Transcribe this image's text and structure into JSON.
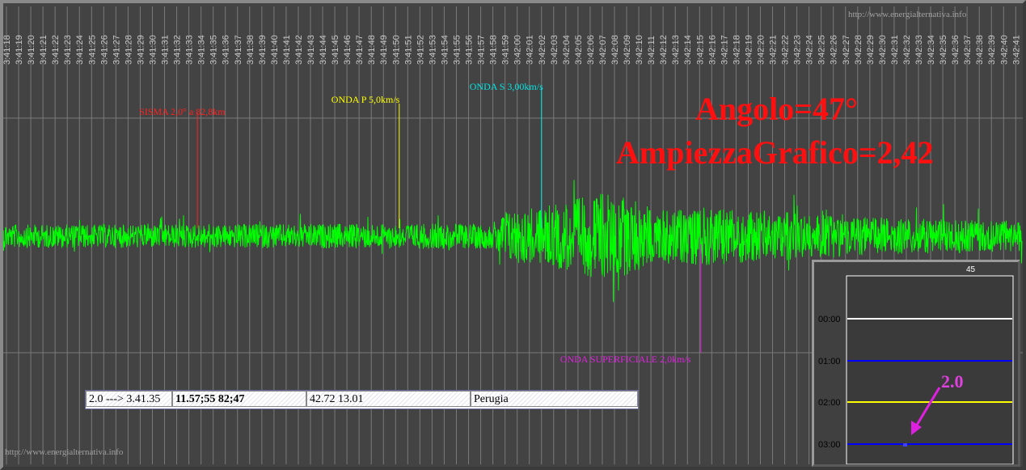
{
  "watermark_top": "http://www.energialternativa.info",
  "watermark_bottom": "http://www.energialternativa.info",
  "chart_data": {
    "type": "line",
    "title": "",
    "xlabel": "",
    "ylabel": "",
    "x_ticks": [
      "3:41:18",
      "3:41:19",
      "3:41:20",
      "3:41:21",
      "3:41:22",
      "3:41:23",
      "3:41:24",
      "3:41:25",
      "3:41:26",
      "3:41:27",
      "3:41:28",
      "3:41:29",
      "3:41:30",
      "3:41:31",
      "3:41:32",
      "3:41:33",
      "3:41:34",
      "3:41:35",
      "3:41:36",
      "3:41:37",
      "3:41:38",
      "3:41:39",
      "3:41:40",
      "3:41:41",
      "3:41:42",
      "3:41:43",
      "3:41:44",
      "3:41:45",
      "3:41:46",
      "3:41:47",
      "3:41:48",
      "3:41:49",
      "3:41:50",
      "3:41:51",
      "3:41:52",
      "3:41:53",
      "3:41:54",
      "3:41:55",
      "3:41:56",
      "3:41:57",
      "3:41:58",
      "3:41:59",
      "3:42:00",
      "3:42:01",
      "3:42:02",
      "3:42:03",
      "3:42:04",
      "3:42:05",
      "3:42:06",
      "3:42:07",
      "3:42:08",
      "3:42:09",
      "3:42:10",
      "3:42:11",
      "3:42:12",
      "3:42:13",
      "3:42:14",
      "3:42:15",
      "3:42:16",
      "3:42:17",
      "3:42:18",
      "3:42:19",
      "3:42:20",
      "3:42:21",
      "3:42:22",
      "3:42:23",
      "3:42:24",
      "3:42:25",
      "3:42:26",
      "3:42:27",
      "3:42:28",
      "3:42:29",
      "3:42:30",
      "3:42:31",
      "3:42:32",
      "3:42:33",
      "3:42:34",
      "3:42:35",
      "3:42:36",
      "3:42:37",
      "3:42:38",
      "3:42:39",
      "3:42:40",
      "3:42:41"
    ],
    "trace_color": "#00ff00",
    "trace_envelope": [
      {
        "t": 0,
        "amp": 0.12
      },
      {
        "t": 40,
        "amp": 0.13
      },
      {
        "t": 41,
        "amp": 0.28
      },
      {
        "t": 44,
        "amp": 0.3
      },
      {
        "t": 49,
        "amp": 0.45
      },
      {
        "t": 52,
        "amp": 0.38
      },
      {
        "t": 53,
        "amp": 0.28
      },
      {
        "t": 58,
        "amp": 0.3
      },
      {
        "t": 70,
        "amp": 0.2
      },
      {
        "t": 84,
        "amp": 0.15
      }
    ],
    "markers": [
      {
        "label": "SISMA 2,0° a 82,8km",
        "time": "3:41:33.7",
        "color": "#ff2020"
      },
      {
        "label": "ONDA P 5,0km/s",
        "time": "3:41:50.3",
        "color": "#ffff00"
      },
      {
        "label": "ONDA S 3,00km/s",
        "time": "3:42:02.0",
        "color": "#00e5e5"
      },
      {
        "label": "ONDA SUPERFICIALE 2,0km/s",
        "time": "3:42:15.1",
        "color": "#e020e0"
      }
    ],
    "annotations": {
      "angolo": "Angolo=47°",
      "ampiezza": "AmpiezzaGrafico=2,42"
    },
    "grid": true
  },
  "info_bar": {
    "magnitude_time": "2.0 ---> 3.41.35",
    "time_detail": "11.57;55 82;47",
    "coordinates": "42.72 13.01",
    "location": "Perugia"
  },
  "inset": {
    "top_label": "45",
    "rows": [
      {
        "label": "00:00",
        "color": "#ffffff"
      },
      {
        "label": "01:00",
        "color": "#0000ff"
      },
      {
        "label": "02:00",
        "color": "#ffff00"
      },
      {
        "label": "03:00",
        "color": "#0000ff"
      }
    ],
    "event_label": "2.0",
    "event_color": "#e020e0"
  }
}
